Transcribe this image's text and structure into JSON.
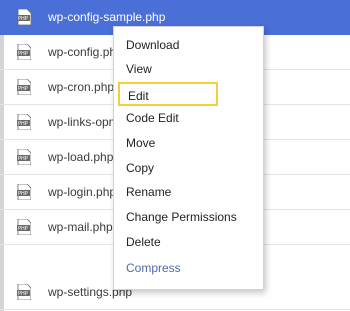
{
  "files": [
    {
      "name": "wp-config-sample.php",
      "icon": "php-file-icon",
      "selected": true
    },
    {
      "name": "wp-config.php",
      "icon": "php-file-icon"
    },
    {
      "name": "wp-cron.php",
      "icon": "php-file-icon"
    },
    {
      "name": "wp-links-opml.php",
      "icon": "php-file-icon"
    },
    {
      "name": "wp-load.php",
      "icon": "php-file-icon"
    },
    {
      "name": "wp-login.php",
      "icon": "php-file-icon"
    },
    {
      "name": "wp-mail.php",
      "icon": "php-file-icon"
    },
    {
      "name": "wp-settings.php",
      "icon": "php-file-icon"
    }
  ],
  "icon_label": "PHP",
  "context_menu": {
    "items": [
      {
        "label": "Download"
      },
      {
        "label": "View"
      },
      {
        "label": "Edit",
        "highlighted": true
      },
      {
        "label": "Code Edit"
      },
      {
        "label": "Move"
      },
      {
        "label": "Copy"
      },
      {
        "label": "Rename"
      },
      {
        "label": "Change Permissions"
      },
      {
        "label": "Delete"
      },
      {
        "label": "Compress"
      }
    ]
  },
  "colors": {
    "selected_row": "#4a6fd6",
    "highlight_border": "#f3cf3a",
    "compress_text": "#4f6aa8"
  }
}
